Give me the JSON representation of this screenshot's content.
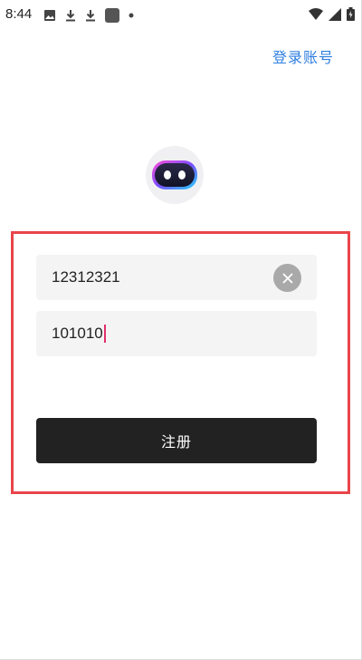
{
  "status_bar": {
    "time": "8:44",
    "icons_left": [
      "image-icon",
      "download-icon",
      "download-icon",
      "app-square-icon",
      "dot-icon"
    ],
    "icons_right": [
      "wifi-icon",
      "signal-icon",
      "battery-icon"
    ]
  },
  "header": {
    "login_link": "登录账号"
  },
  "form": {
    "username_value": "12312321",
    "password_value": "101010",
    "submit_label": "注册"
  },
  "colors": {
    "link": "#2f7fe0",
    "button_bg": "#222222",
    "highlight_border": "#e8454a",
    "field_bg": "#f4f4f4"
  }
}
